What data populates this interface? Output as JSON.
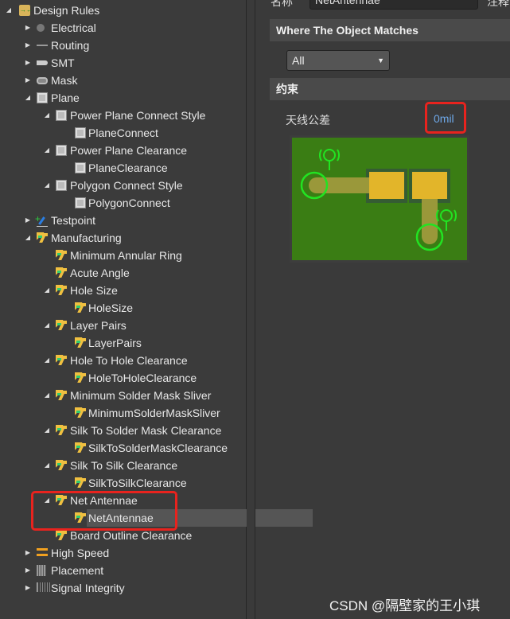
{
  "tree": [
    {
      "label": "Design Rules",
      "level": 0,
      "toggle": "expanded",
      "icon": "folder-rules"
    },
    {
      "label": "Electrical",
      "level": 1,
      "toggle": "collapsed",
      "icon": "electrical"
    },
    {
      "label": "Routing",
      "level": 1,
      "toggle": "collapsed",
      "icon": "routing"
    },
    {
      "label": "SMT",
      "level": 1,
      "toggle": "collapsed",
      "icon": "smt"
    },
    {
      "label": "Mask",
      "level": 1,
      "toggle": "collapsed",
      "icon": "mask"
    },
    {
      "label": "Plane",
      "level": 1,
      "toggle": "expanded",
      "icon": "plane"
    },
    {
      "label": "Power Plane Connect Style",
      "level": 2,
      "toggle": "expanded",
      "icon": "plane"
    },
    {
      "label": "PlaneConnect",
      "level": 3,
      "toggle": null,
      "icon": "plane"
    },
    {
      "label": "Power Plane Clearance",
      "level": 2,
      "toggle": "expanded",
      "icon": "plane"
    },
    {
      "label": "PlaneClearance",
      "level": 3,
      "toggle": null,
      "icon": "plane"
    },
    {
      "label": "Polygon Connect Style",
      "level": 2,
      "toggle": "expanded",
      "icon": "plane"
    },
    {
      "label": "PolygonConnect",
      "level": 3,
      "toggle": null,
      "icon": "plane"
    },
    {
      "label": "Testpoint",
      "level": 1,
      "toggle": "collapsed",
      "icon": "testpoint"
    },
    {
      "label": "Manufacturing",
      "level": 1,
      "toggle": "expanded",
      "icon": "manufacturing"
    },
    {
      "label": "Minimum Annular Ring",
      "level": 2,
      "toggle": null,
      "icon": "manufacturing"
    },
    {
      "label": "Acute Angle",
      "level": 2,
      "toggle": null,
      "icon": "manufacturing"
    },
    {
      "label": "Hole Size",
      "level": 2,
      "toggle": "expanded",
      "icon": "manufacturing"
    },
    {
      "label": "HoleSize",
      "level": 3,
      "toggle": null,
      "icon": "manufacturing"
    },
    {
      "label": "Layer Pairs",
      "level": 2,
      "toggle": "expanded",
      "icon": "manufacturing"
    },
    {
      "label": "LayerPairs",
      "level": 3,
      "toggle": null,
      "icon": "manufacturing"
    },
    {
      "label": "Hole To Hole Clearance",
      "level": 2,
      "toggle": "expanded",
      "icon": "manufacturing"
    },
    {
      "label": "HoleToHoleClearance",
      "level": 3,
      "toggle": null,
      "icon": "manufacturing"
    },
    {
      "label": "Minimum Solder Mask Sliver",
      "level": 2,
      "toggle": "expanded",
      "icon": "manufacturing"
    },
    {
      "label": "MinimumSolderMaskSliver",
      "level": 3,
      "toggle": null,
      "icon": "manufacturing"
    },
    {
      "label": "Silk To Solder Mask Clearance",
      "level": 2,
      "toggle": "expanded",
      "icon": "manufacturing"
    },
    {
      "label": "SilkToSolderMaskClearance",
      "level": 3,
      "toggle": null,
      "icon": "manufacturing"
    },
    {
      "label": "Silk To Silk Clearance",
      "level": 2,
      "toggle": "expanded",
      "icon": "manufacturing"
    },
    {
      "label": "SilkToSilkClearance",
      "level": 3,
      "toggle": null,
      "icon": "manufacturing"
    },
    {
      "label": "Net Antennae",
      "level": 2,
      "toggle": "expanded",
      "icon": "manufacturing"
    },
    {
      "label": "NetAntennae",
      "level": 3,
      "toggle": null,
      "icon": "manufacturing",
      "selected": true
    },
    {
      "label": "Board Outline Clearance",
      "level": 2,
      "toggle": null,
      "icon": "manufacturing"
    },
    {
      "label": "High Speed",
      "level": 1,
      "toggle": "collapsed",
      "icon": "high-speed"
    },
    {
      "label": "Placement",
      "level": 1,
      "toggle": "collapsed",
      "icon": "placement"
    },
    {
      "label": "Signal Integrity",
      "level": 1,
      "toggle": "collapsed",
      "icon": "signal-integrity"
    }
  ],
  "rule": {
    "name_label": "名称",
    "name_value": "NetAntennae",
    "comment_label": "注释",
    "where_header": "Where The Object Matches",
    "where_value": "All",
    "constraints_header": "约束",
    "tolerance_label": "天线公差",
    "tolerance_value": "0mil"
  },
  "colors": {
    "highlight": "#e8231e",
    "board": "#3a7d14",
    "pad": "#e2b52a",
    "track": "#9a983a",
    "antenna": "#22e322",
    "value": "#6ea8e8"
  },
  "watermark": "CSDN @隔壁家的王小琪"
}
